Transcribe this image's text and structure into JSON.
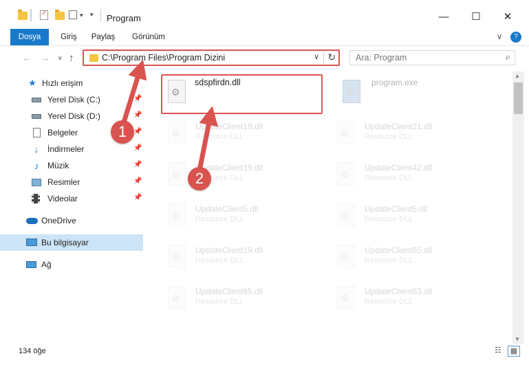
{
  "window": {
    "title": "Program",
    "minimize_glyph": "—",
    "maximize_glyph": "☐",
    "close_glyph": "✕"
  },
  "ribbon": {
    "tabs": [
      "Dosya",
      "Giriş",
      "Paylaş",
      "Görünüm"
    ],
    "collapse_glyph": "∨",
    "help_glyph": "?"
  },
  "navigation": {
    "back_glyph": "←",
    "forward_glyph": "→",
    "recent_glyph": "∨",
    "up_glyph": "↑",
    "address": "C:\\Program Files\\Program Dizini",
    "dropdown_glyph": "∨",
    "refresh_glyph": "↻",
    "search_placeholder": "Ara: Program",
    "search_glyph": "⌕"
  },
  "sidebar": {
    "pin_glyph": "📌",
    "items": [
      {
        "label": "Hızlı erişim",
        "icon": "star-icon"
      },
      {
        "label": "Yerel Disk (C:)",
        "icon": "drive-icon"
      },
      {
        "label": "Yerel Disk (D:)",
        "icon": "drive-icon"
      },
      {
        "label": "Belgeler",
        "icon": "documents-icon"
      },
      {
        "label": "İndirmeler",
        "icon": "download-icon"
      },
      {
        "label": "Müzik",
        "icon": "music-icon"
      },
      {
        "label": "Resimler",
        "icon": "pictures-icon"
      },
      {
        "label": "Videolar",
        "icon": "video-icon"
      },
      {
        "label": "OneDrive",
        "icon": "cloud-icon"
      },
      {
        "label": "Bu bilgisayar",
        "icon": "computer-icon"
      },
      {
        "label": "Ağ",
        "icon": "network-icon"
      }
    ]
  },
  "files": {
    "highlighted": {
      "name": "sdspfirdn.dll"
    },
    "program": {
      "name": "program.exe"
    },
    "faded": [
      {
        "name": "UpdateClient19.dll",
        "type": "Resource DLL"
      },
      {
        "name": "UpdateClient21.dll",
        "type": "Resource DLL"
      },
      {
        "name": "UpdateClient19.dll",
        "type": "Resource DLL"
      },
      {
        "name": "UpdateClient42.dll",
        "type": "Resource DLL"
      },
      {
        "name": "UpdateClient5.dll",
        "type": "Resource DLL"
      },
      {
        "name": "UpdateClient5.dll",
        "type": "Resource DLL"
      },
      {
        "name": "UpdateClient19.dll",
        "type": "Resource DLL"
      },
      {
        "name": "UpdateClient65.dll",
        "type": "Resource DLL"
      },
      {
        "name": "UpdateClient65.dll",
        "type": "Resource DLL"
      },
      {
        "name": "UpdateClient63.dll",
        "type": "Resource DLL"
      }
    ]
  },
  "status": {
    "item_count": "134 öğe",
    "details_view_glyph": "☷",
    "icons_view_glyph": "▦"
  },
  "callouts": [
    "1",
    "2"
  ],
  "colors": {
    "accent": "#1979ca",
    "highlight_red": "#d9534f",
    "selection": "#cce4f7"
  }
}
